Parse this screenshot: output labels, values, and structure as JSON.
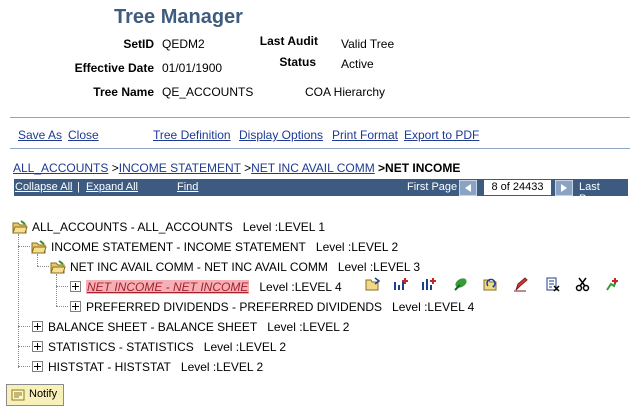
{
  "header": {
    "title": "Tree Manager",
    "setid_label": "SetID",
    "setid_value": "QEDM2",
    "effdate_label": "Effective Date",
    "effdate_value": "01/01/1900",
    "treename_label": "Tree Name",
    "treename_value": "QE_ACCOUNTS",
    "treename_desc": "COA Hierarchy",
    "lastaudit_label": "Last Audit",
    "lastaudit_value": "Valid Tree",
    "status_label": "Status",
    "status_value": "Active"
  },
  "toolbar": {
    "save_as": "Save As",
    "close": "Close",
    "tree_definition": "Tree Definition",
    "display_options": "Display Options",
    "print_format": "Print Format",
    "export_pdf": "Export to PDF"
  },
  "breadcrumb": {
    "items": [
      "ALL_ACCOUNTS",
      "INCOME STATEMENT",
      "NET INC AVAIL COMM"
    ],
    "separator": ">",
    "current": ">NET INCOME"
  },
  "navbar": {
    "collapse_all": "Collapse All",
    "divider": "|",
    "expand_all": "Expand All",
    "find": "Find",
    "first_page": "First Page",
    "page_info": "8 of 24433",
    "last_page": "Last Page"
  },
  "tree": {
    "nodes": [
      {
        "label": "ALL_ACCOUNTS - ALL_ACCOUNTS",
        "level": "Level :LEVEL 1",
        "icon": "open-folder-icon"
      },
      {
        "label": "INCOME STATEMENT - INCOME STATEMENT",
        "level": "Level :LEVEL 2",
        "icon": "open-folder-icon"
      },
      {
        "label": "NET INC AVAIL COMM - NET INC AVAIL COMM",
        "level": "Level :LEVEL 3",
        "icon": "open-folder-icon"
      },
      {
        "label": "NET INCOME - NET INCOME",
        "level": "Level :LEVEL 4",
        "icon": "expand-icon",
        "selected": true
      },
      {
        "label": "PREFERRED DIVIDENDS - PREFERRED DIVIDENDS",
        "level": "Level :LEVEL 4",
        "icon": "expand-icon"
      },
      {
        "label": "BALANCE SHEET - BALANCE SHEET",
        "level": "Level :LEVEL 2",
        "icon": "expand-icon"
      },
      {
        "label": "STATISTICS - STATISTICS",
        "level": "Level :LEVEL 2",
        "icon": "expand-icon"
      },
      {
        "label": "HISTSTAT - HISTSTAT",
        "level": "Level :LEVEL 2",
        "icon": "expand-icon"
      }
    ]
  },
  "actions": [
    "insert-sibling-icon",
    "insert-child-detail-icon",
    "insert-child-node-icon",
    "edit-data-icon",
    "move-node-icon",
    "edit-node-icon",
    "delete-node-icon",
    "cut-icon",
    "paste-icon"
  ],
  "notify": {
    "label": "Notify"
  },
  "colors": {
    "title": "#3f5c7f",
    "navbar": "#3d5a80",
    "link": "#1f3a93",
    "selected_bg": "#f4b0b6",
    "selected_text": "#a8202a"
  }
}
